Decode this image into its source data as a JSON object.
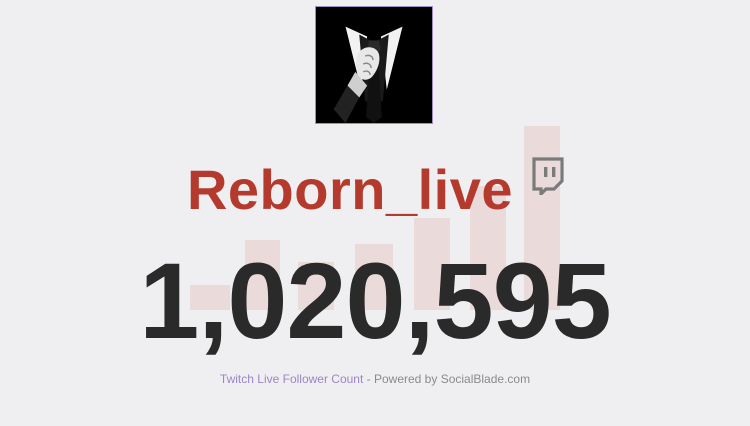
{
  "channel": {
    "name": "Reborn_live",
    "platform_icon": "twitch-icon",
    "avatar_icon": "suit-and-tie-icon"
  },
  "stats": {
    "follower_count": "1,020,595"
  },
  "footer": {
    "label": "Twitch Live Follower Count",
    "separator": " - ",
    "powered_by": "Powered by SocialBlade.com"
  },
  "colors": {
    "background": "#efeff1",
    "channel_name": "#b53a2e",
    "count": "#2a2a2a",
    "footer_label": "#9b86c4",
    "footer_text": "#8a8a8a",
    "bar_tint": "#e9d6d6"
  }
}
